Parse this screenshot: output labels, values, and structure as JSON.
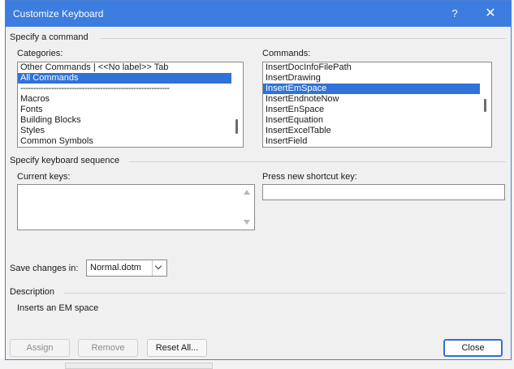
{
  "window": {
    "title": "Customize Keyboard",
    "help_glyph": "?",
    "close_glyph": "✕"
  },
  "specify_command": {
    "heading": "Specify a command",
    "categories": {
      "label": "Categories:",
      "items": [
        "Other Commands | <<No label>> Tab",
        "All Commands",
        "----------------------------------------------------------",
        "Macros",
        "Fonts",
        "Building Blocks",
        "Styles",
        "Common Symbols"
      ],
      "selected_index": 1
    },
    "commands": {
      "label": "Commands:",
      "items": [
        "InsertDocInfoFilePath",
        "InsertDrawing",
        "InsertEmSpace",
        "InsertEndnoteNow",
        "InsertEnSpace",
        "InsertEquation",
        "InsertExcelTable",
        "InsertField"
      ],
      "selected_index": 2
    }
  },
  "keyboard_sequence": {
    "heading": "Specify keyboard sequence",
    "current_keys_label": "Current keys:",
    "current_keys_value": "",
    "new_shortcut_label": "Press new shortcut key:",
    "new_shortcut_value": ""
  },
  "save_changes": {
    "label": "Save changes in:",
    "value": "Normal.dotm"
  },
  "description": {
    "heading": "Description",
    "text": "Inserts an EM space"
  },
  "buttons": {
    "assign": "Assign",
    "remove": "Remove",
    "reset_all": "Reset All...",
    "close": "Close"
  },
  "colors": {
    "titlebar": "#3c7ddf",
    "selection": "#3072d8",
    "dialog_bg": "#f0f0f0"
  }
}
